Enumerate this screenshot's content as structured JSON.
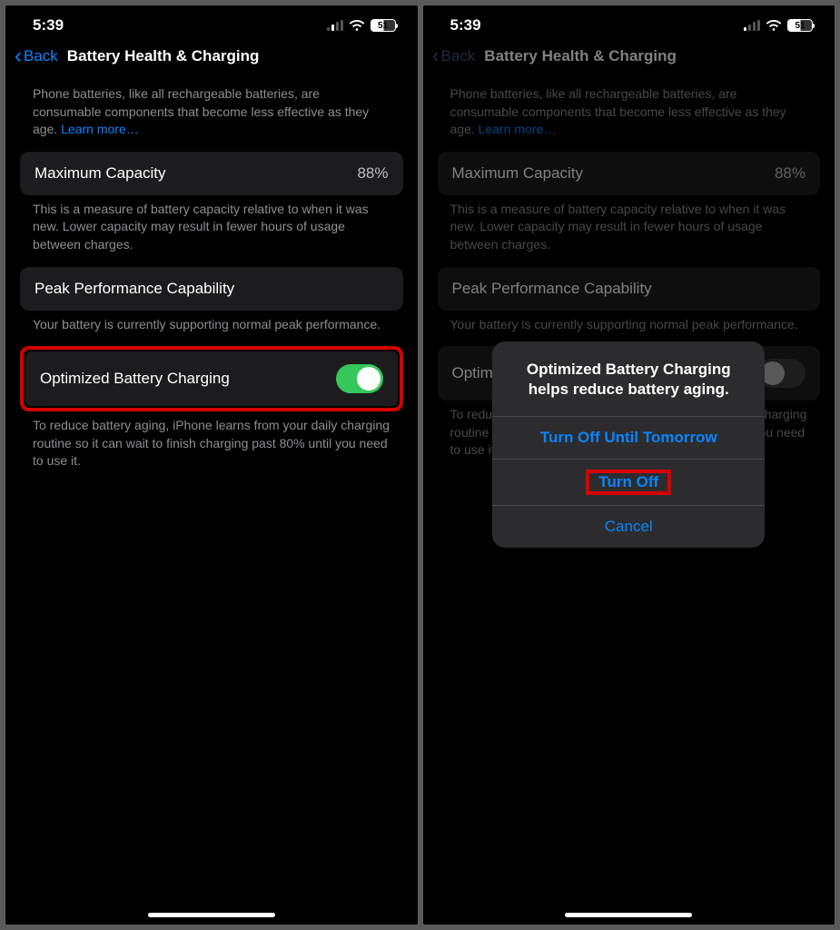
{
  "status": {
    "time": "5:39",
    "battery_pct": "51"
  },
  "nav": {
    "back": "Back",
    "title": "Battery Health & Charging"
  },
  "intro": {
    "text": "Phone batteries, like all rechargeable batteries, are consumable components that become less effective as they age. ",
    "learn_more": "Learn more…"
  },
  "maxcap": {
    "label": "Maximum Capacity",
    "value": "88%",
    "foot": "This is a measure of battery capacity relative to when it was new. Lower capacity may result in fewer hours of usage between charges."
  },
  "peak": {
    "label": "Peak Performance Capability",
    "foot": "Your battery is currently supporting normal peak performance."
  },
  "optimized": {
    "label": "Optimized Battery Charging",
    "foot": "To reduce battery aging, iPhone learns from your daily charging routine so it can wait to finish charging past 80% until you need to use it."
  },
  "alert": {
    "title": "Optimized Battery Charging helps reduce battery aging.",
    "option1": "Turn Off Until Tomorrow",
    "option2": "Turn Off",
    "cancel": "Cancel"
  }
}
